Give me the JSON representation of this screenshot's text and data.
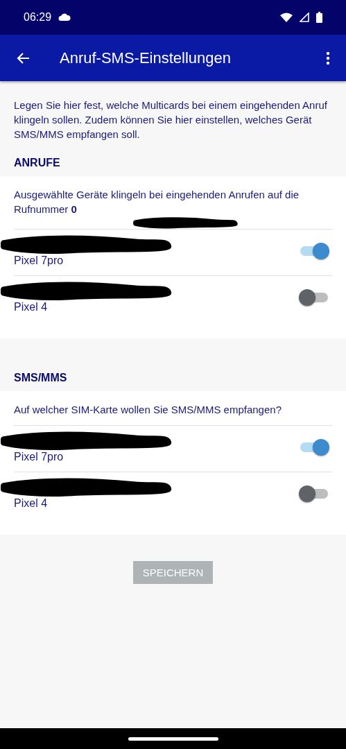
{
  "status_bar": {
    "time": "06:29"
  },
  "app_bar": {
    "title": "Anruf-SMS-Einstellungen"
  },
  "intro": "Legen Sie hier fest, welche Multicards bei einem eingehenden Anruf klingeln sollen. Zudem können Sie hier einstellen, welches Gerät SMS/MMS empfangen soll.",
  "sections": [
    {
      "heading": "ANRUFE",
      "description": "Ausgewählte Geräte klingeln bei eingehenden Anrufen auf die Rufnummer **0**",
      "description_redacted": true,
      "devices": [
        {
          "device": "Pixel 7pro",
          "on": true
        },
        {
          "device": "Pixel 4",
          "on": false
        }
      ]
    },
    {
      "heading": "SMS/MMS",
      "description": "Auf welcher SIM-Karte wollen Sie SMS/MMS empfangen?",
      "description_redacted": false,
      "devices": [
        {
          "device": "Pixel 7pro",
          "on": true
        },
        {
          "device": "Pixel 4",
          "on": false
        }
      ]
    }
  ],
  "save_button": {
    "label": "SPEICHERN",
    "disabled": true
  }
}
